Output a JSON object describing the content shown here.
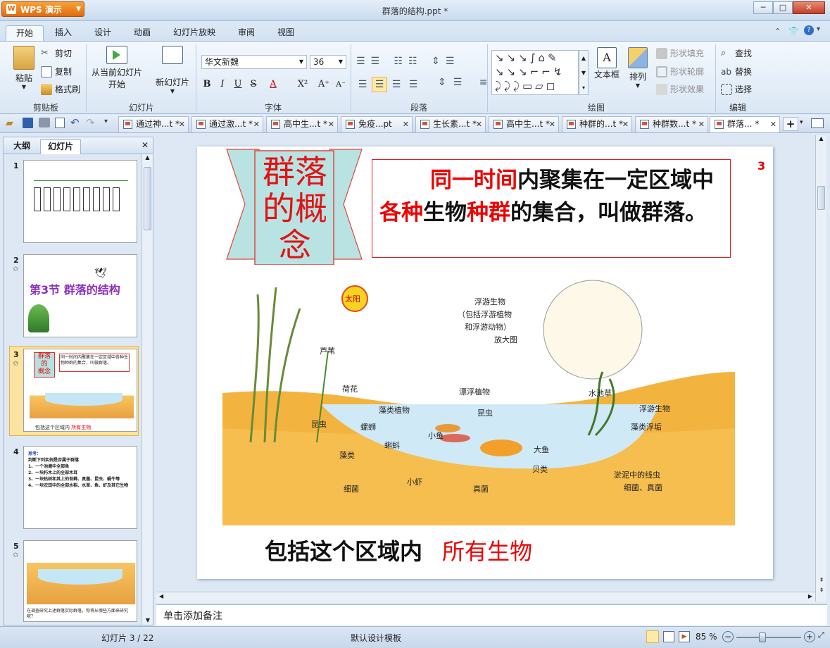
{
  "app": {
    "name": "WPS 演示",
    "doc_title": "群落的结构.ppt *"
  },
  "ribbon_tabs": [
    "开始",
    "插入",
    "设计",
    "动画",
    "幻灯片放映",
    "审阅",
    "视图"
  ],
  "ribbon": {
    "clipboard": {
      "paste": "粘贴",
      "cut": "剪切",
      "copy": "复制",
      "format_painter": "格式刷",
      "label": "剪贴板"
    },
    "slides": {
      "from_current": "从当前幻灯片",
      "start": "开始",
      "new_slide": "新幻灯片",
      "label": "幻灯片"
    },
    "font": {
      "name": "华文新魏",
      "size": "36",
      "label": "字体"
    },
    "paragraph": {
      "label": "段落"
    },
    "drawing": {
      "textbox": "文本框",
      "arrange": "排列",
      "shape_fill": "形状填充",
      "shape_outline": "形状轮廓",
      "shape_effect": "形状效果",
      "label": "绘图"
    },
    "editing": {
      "find": "查找",
      "replace": "替换",
      "select": "选择",
      "label": "编辑"
    }
  },
  "doc_tabs": [
    "通过神...t *",
    "通过激...t *",
    "高中生...t *",
    "免疫...pt",
    "生长素...t *",
    "高中生...t *",
    "种群的...t *",
    "种群数...t *",
    "群落... *"
  ],
  "left_pane": {
    "tab_outline": "大纲",
    "tab_slides": "幻灯片"
  },
  "thumbnails": [
    {
      "num": "1"
    },
    {
      "num": "2",
      "text": "第3节 群落的结构"
    },
    {
      "num": "3",
      "caption_a": "包括这个区域内",
      "caption_b": "所有生物"
    },
    {
      "num": "4",
      "lines": [
        "思考：",
        "判断下列实例是否属于群落",
        "1、一个池塘中全部鱼",
        "2、一块朽木上的全部木耳",
        "3、一块枯树和其上的苔藓、真菌、昆虫、蜗牛等",
        "4、一块农田中的全部水稻、水草、鱼、虾及其它生物"
      ]
    },
    {
      "num": "5",
      "footer": "在调查研究上述群落实际群落，你将从哪些方面来研究呢？"
    }
  ],
  "slide": {
    "page_number": "3",
    "title": "群落的概念",
    "def_red1": "同一时间",
    "def_black1": "内聚集在一定区域中",
    "def_red2": "各种",
    "def_black2": "生物",
    "def_red3": "种群",
    "def_black3": "的集合，叫做群落。",
    "caption": "包括这个区域内",
    "caption_red": "所有生物",
    "figure_labels": {
      "sun": "太阳",
      "reed": "芦苇",
      "lotus": "荷花",
      "plankton": "漂浮植物",
      "waterweed": "水池草",
      "algae": "藻类植物",
      "mussel": "螺蛳",
      "insect1": "昆虫",
      "insect2": "昆虫",
      "fish_small": "小鱼",
      "tadpole": "蝌蚪",
      "fish_big": "大鱼",
      "algae2": "藻类",
      "shellfish": "贝类",
      "shrimp": "小虾",
      "bacteria": "细菌",
      "fungi": "真菌",
      "floating": "浮游生物",
      "algae_scum": "藻类浮垢",
      "worms": "淤泥中的线虫",
      "worms2": "细菌、真菌",
      "zoom1": "浮游生物",
      "zoom2": "（包括浮游植物",
      "zoom3": "和浮游动物）",
      "zoom4": "放大图"
    }
  },
  "notes_placeholder": "单击添加备注",
  "status": {
    "slide_counter": "幻灯片 3 / 22",
    "template": "默认设计模板",
    "zoom": "85 %"
  }
}
